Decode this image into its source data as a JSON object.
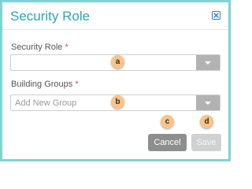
{
  "dialog": {
    "title": "Security Role",
    "close_icon": "close-x-icon"
  },
  "fields": {
    "security_role": {
      "label": "Security Role",
      "required_mark": "*",
      "value": "",
      "placeholder": "",
      "callout": "a"
    },
    "building_groups": {
      "label": "Building Groups",
      "required_mark": "*",
      "value": "",
      "placeholder": "Add New Group",
      "callout": "b"
    }
  },
  "buttons": {
    "cancel": {
      "label": "Cancel",
      "callout": "c"
    },
    "save": {
      "label": "Save",
      "callout": "d",
      "disabled": true
    }
  },
  "colors": {
    "border": "#7fd3d3",
    "title": "#2aa7b3",
    "required": "#d9534f",
    "dropdown_button": "#b2b2b2",
    "cancel_button": "#8e8e8e",
    "save_button_disabled": "#d1d1d1",
    "callout": "#f8c48c"
  }
}
